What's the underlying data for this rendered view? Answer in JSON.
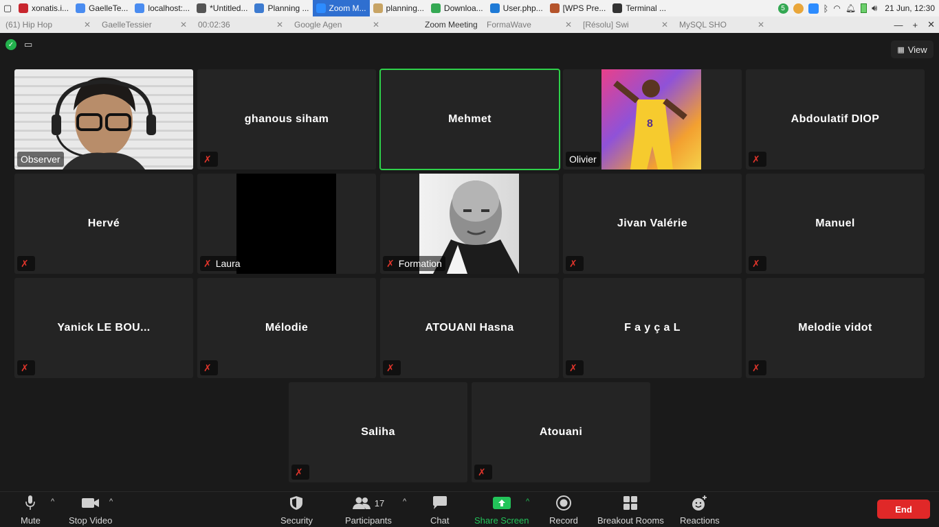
{
  "taskbar": {
    "items": [
      {
        "label": "xonatis.i...",
        "color": "#c8262e"
      },
      {
        "label": "GaelleTe...",
        "color": "#4a8cf0"
      },
      {
        "label": "localhost:...",
        "color": "#4a8cf0"
      },
      {
        "label": "*Untitled...",
        "color": "#555555"
      },
      {
        "label": "Planning ...",
        "color": "#3d7bd0"
      },
      {
        "label": "Zoom M...",
        "color": "#2d8cff"
      },
      {
        "label": "planning...",
        "color": "#c8a464"
      },
      {
        "label": "Downloa...",
        "color": "#34a853"
      },
      {
        "label": "User.php...",
        "color": "#1e7ad6"
      },
      {
        "label": "[WPS Pre...",
        "color": "#b5542b"
      },
      {
        "label": "Terminal ...",
        "color": "#333333"
      }
    ],
    "tray_badge": "5",
    "clock": "21 Jun, 12:30"
  },
  "browser_tabs": [
    "(61) Hip Hop",
    "GaelleTessier",
    "00:02:36",
    "Google Agen",
    "",
    "FormaWave",
    "[Résolu] Swi",
    "MySQL SHO"
  ],
  "zoom": {
    "window_title": "Zoom Meeting",
    "view_label": "View",
    "participants": [
      {
        "name": "Observer",
        "label": "Observer"
      },
      {
        "name": "ghanous siham"
      },
      {
        "name": "Mehmet"
      },
      {
        "name": "Olivier",
        "label": "Olivier"
      },
      {
        "name": "Abdoulatif DIOP"
      },
      {
        "name": "Hervé"
      },
      {
        "name": "Laura",
        "label": "Laura"
      },
      {
        "name": "Formation",
        "label": "Formation"
      },
      {
        "name": "Jivan Valérie"
      },
      {
        "name": "Manuel"
      },
      {
        "name": "Yanick LE BOU..."
      },
      {
        "name": "Mélodie"
      },
      {
        "name": "ATOUANI Hasna"
      },
      {
        "name": "F a y ç a L"
      },
      {
        "name": "Melodie vidot"
      },
      {
        "name": "Saliha"
      },
      {
        "name": "Atouani"
      }
    ],
    "toolbar": {
      "mute": "Mute",
      "stop_video": "Stop Video",
      "security": "Security",
      "participants": "Participants",
      "participants_count": "17",
      "chat": "Chat",
      "share_screen": "Share Screen",
      "record": "Record",
      "breakout": "Breakout Rooms",
      "reactions": "Reactions",
      "end": "End"
    },
    "colors": {
      "speaking_border": "#2ed24a",
      "share_green": "#23c45a",
      "end_red": "#e02828",
      "muted_red": "#e0352b"
    }
  }
}
